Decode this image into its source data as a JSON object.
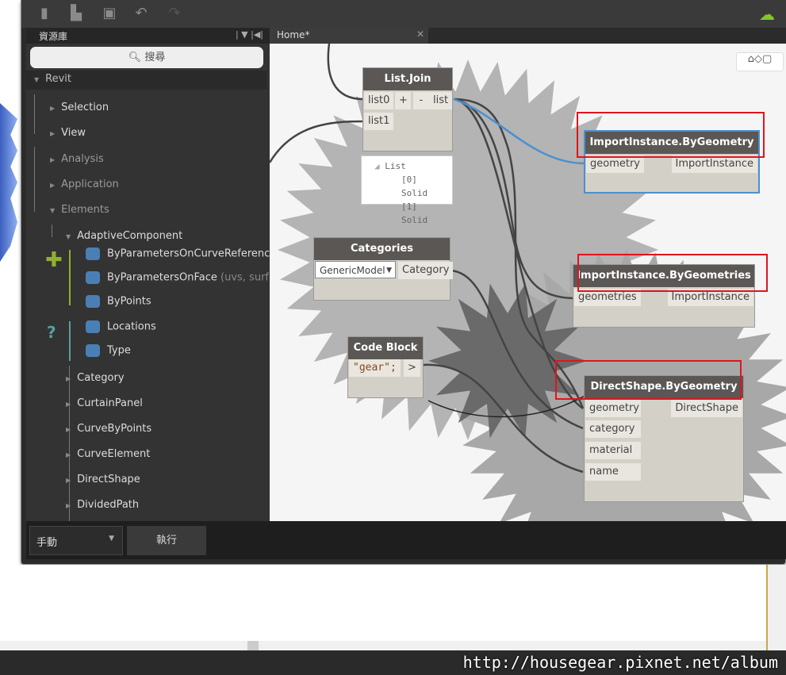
{
  "toolbar": {
    "icons": [
      "new-file-icon",
      "open-icon",
      "save-icon",
      "undo-icon",
      "redo-icon",
      "cloud-download-icon"
    ],
    "accent": "#7ec82a"
  },
  "library": {
    "title": "資源庫",
    "search_placeholder": "搜尋",
    "root": "Revit",
    "items": [
      {
        "label": "Selection"
      },
      {
        "label": "View"
      },
      {
        "label": "Analysis"
      },
      {
        "label": "Application"
      },
      {
        "label": "Elements"
      },
      {
        "label": "AdaptiveComponent"
      },
      {
        "label": "ByParametersOnCurveReference"
      },
      {
        "label": "ByParametersOnFace",
        "hint": "(uvs, surfac"
      },
      {
        "label": "ByPoints"
      },
      {
        "label": "Locations"
      },
      {
        "label": "Type"
      },
      {
        "label": "Category"
      },
      {
        "label": "CurtainPanel"
      },
      {
        "label": "CurveByPoints"
      },
      {
        "label": "CurveElement"
      },
      {
        "label": "DirectShape"
      },
      {
        "label": "DividedPath"
      }
    ]
  },
  "tab": {
    "label": "Home*",
    "close": "✕"
  },
  "nodes": {
    "listjoin": {
      "title": "List.Join",
      "in": [
        "list0",
        "list1"
      ],
      "plus": "+",
      "minus": "-",
      "out": "list",
      "preview": {
        "head": "List",
        "rows": [
          "[0] Solid",
          "[1] Solid"
        ]
      }
    },
    "categories": {
      "title": "Categories",
      "value": "GenericModel",
      "out": "Category"
    },
    "codeblock": {
      "title": "Code Block",
      "code": "\"gear\";",
      "out": ">"
    },
    "importgeom": {
      "title": "ImportInstance.ByGeometry",
      "in": "geometry",
      "out": "ImportInstance"
    },
    "importgeoms": {
      "title": "ImportInstance.ByGeometries",
      "in": "geometries",
      "out": "ImportInstance"
    },
    "directshape": {
      "title": "DirectShape.ByGeometry",
      "in": [
        "geometry",
        "category",
        "material",
        "name"
      ],
      "out": "DirectShape"
    }
  },
  "highlight_color": "#e0141e",
  "run": {
    "mode": "手動",
    "button": "執行"
  },
  "status": {
    "watermark": "http://housegear.pixnet.net/album"
  }
}
